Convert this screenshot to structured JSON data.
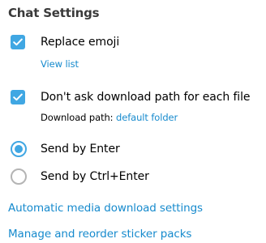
{
  "section": {
    "title": "Chat Settings"
  },
  "options": {
    "replace_emoji": {
      "label": "Replace emoji",
      "checked": true,
      "sub_link": "View list"
    },
    "download_path": {
      "label": "Don't ask download path for each file",
      "checked": true,
      "sub_prefix": "Download path:",
      "sub_link": "default folder"
    }
  },
  "send_mode": {
    "selected": "Send by Enter",
    "options": [
      {
        "label": "Send by Enter",
        "selected": true
      },
      {
        "label": "Send by Ctrl+Enter",
        "selected": false
      }
    ]
  },
  "links": {
    "media_download": "Automatic media download settings",
    "sticker_packs": "Manage and reorder sticker packs"
  },
  "colors": {
    "accent": "#40a7e3",
    "link": "#168acd",
    "radio_off": "#b4b4b4"
  }
}
